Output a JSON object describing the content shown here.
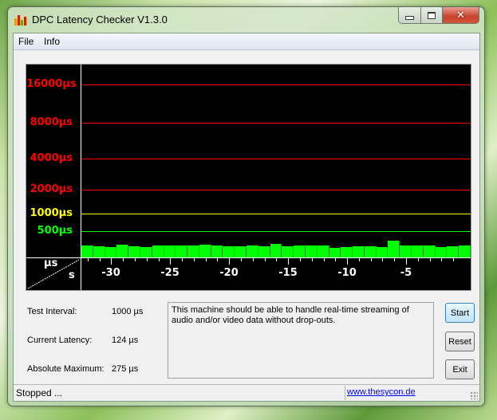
{
  "window": {
    "title": "DPC Latency Checker V1.3.0",
    "icon": "bar-chart-app-icon",
    "controls": {
      "minimize": "minimize-icon",
      "maximize": "maximize-icon",
      "close": "close-icon"
    }
  },
  "menu": [
    {
      "label": "File"
    },
    {
      "label": "Info"
    }
  ],
  "chart_data": {
    "type": "bar",
    "title": "",
    "xlabel": "s",
    "ylabel": "µs",
    "yscale": "log",
    "ylevels": [
      {
        "value": 16000,
        "label": "16000µs",
        "color": "#ff0000"
      },
      {
        "value": 8000,
        "label": "8000µs",
        "color": "#ff0000"
      },
      {
        "value": 4000,
        "label": "4000µs",
        "color": "#ff0000"
      },
      {
        "value": 2000,
        "label": "2000µs",
        "color": "#ff0000"
      },
      {
        "value": 1000,
        "label": "1000µs",
        "color": "#ffff00"
      },
      {
        "value": 500,
        "label": "500µs",
        "color": "#00ff00"
      }
    ],
    "xticks": [
      {
        "value": -30,
        "label": "-30"
      },
      {
        "value": -25,
        "label": "-25"
      },
      {
        "value": -20,
        "label": "-20"
      },
      {
        "value": -15,
        "label": "-15"
      },
      {
        "value": -10,
        "label": "-10"
      },
      {
        "value": -5,
        "label": "-5"
      }
    ],
    "xlim": [
      -33,
      0
    ],
    "bar_color": "#00ff00",
    "values": [
      170,
      160,
      150,
      185,
      160,
      150,
      170,
      170,
      170,
      170,
      190,
      180,
      160,
      160,
      180,
      160,
      200,
      160,
      170,
      180,
      170,
      140,
      150,
      160,
      160,
      150,
      275,
      170,
      170,
      170,
      150,
      160,
      175
    ]
  },
  "info": {
    "test_interval_label": "Test Interval:",
    "test_interval_value": "1000 µs",
    "current_latency_label": "Current Latency:",
    "current_latency_value": "124 µs",
    "absolute_max_label": "Absolute Maximum:",
    "absolute_max_value": "275 µs"
  },
  "message": "This machine should be able to handle real-time streaming of audio and/or video data without drop-outs.",
  "buttons": {
    "start": "Start",
    "reset": "Reset",
    "exit": "Exit"
  },
  "status": {
    "text": "Stopped ...",
    "link": "www.thesycon.de"
  }
}
